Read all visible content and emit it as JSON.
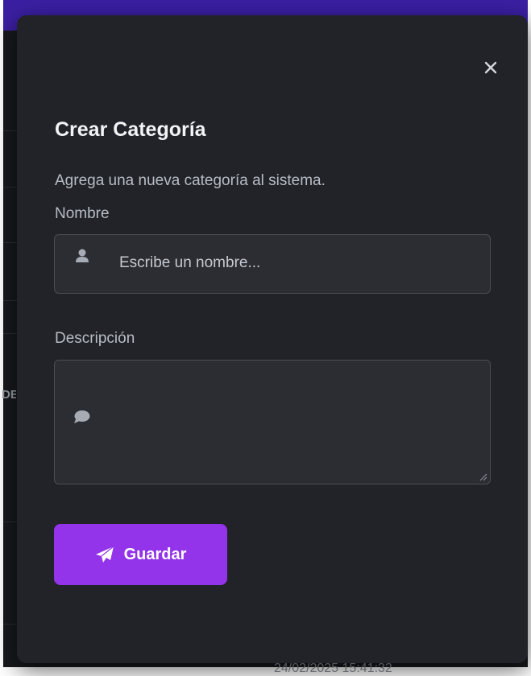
{
  "modal": {
    "title": "Crear Categoría",
    "description": "Agrega una nueva categoría al sistema.",
    "close_icon": "close-icon",
    "fields": {
      "name": {
        "label": "Nombre",
        "placeholder": "Escribe un nombre...",
        "value": "",
        "icon": "user-icon"
      },
      "description": {
        "label": "Descripción",
        "value": "",
        "icon": "comment-icon"
      }
    },
    "save_button": {
      "label": "Guardar",
      "icon": "paper-plane-icon"
    }
  },
  "background": {
    "peek_text": "DE",
    "bottom_text": "24/02/2025 15:41:32"
  },
  "colors": {
    "accent": "#9333ea",
    "modal_bg": "#212328",
    "input_bg": "#2b2d33",
    "topbar": "#3b1fa3"
  }
}
